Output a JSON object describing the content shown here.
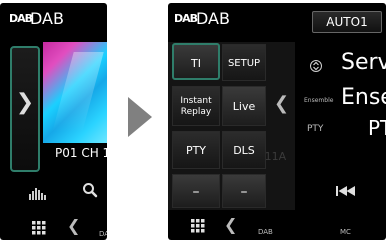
{
  "left_screen": {
    "logo_text": "DAB",
    "title": "DAB",
    "handle_chevron": "❯",
    "channel_text": "P01  CH 1",
    "nav_chevron": "❮",
    "tiny_label": "DA"
  },
  "right_screen": {
    "logo_text": "DAB",
    "title": "DAB",
    "auto_button": "AUTO1",
    "buttons": {
      "ti": "TI",
      "setup": "SETUP",
      "replay_line1": "Instant",
      "replay_line2": "Replay",
      "live": "Live",
      "pty": "PTY",
      "dls": "DLS",
      "minus1": "–",
      "minus2": "–"
    },
    "ghost_text": "P1  CH 11A",
    "panel_chevron": "❮",
    "info": {
      "service_label": "Serv",
      "ensemble_label": "Ensemble",
      "ensemble_value": "Ense",
      "pty_label": "PTY",
      "pty_value": "PT"
    },
    "nav_chevron": "❮",
    "bottom_dab": "DAB",
    "bottom_mc": "MC"
  },
  "colors": {
    "highlight": "#2f7d6a",
    "background": "#000000",
    "arrow": "#808080"
  }
}
